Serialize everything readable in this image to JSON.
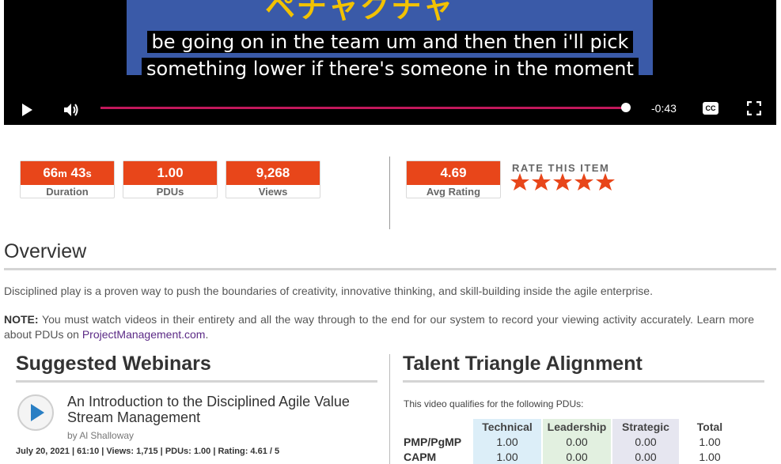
{
  "video": {
    "title_fragment": "ペチャクチャ",
    "caption_line1": "be going on in the team um and then then i'll pick",
    "caption_line2": "something lower if there's someone in the moment",
    "time_remaining": "-0:43",
    "cc_label": "CC",
    "progress": 0.9967
  },
  "stats": [
    {
      "value_main": "66",
      "unit1": "m",
      "value2": "43",
      "unit2": "s",
      "label": "Duration"
    },
    {
      "value": "1.00",
      "label": "PDUs"
    },
    {
      "value": "9,268",
      "label": "Views"
    },
    {
      "value": "4.69",
      "label": "Avg Rating"
    }
  ],
  "rating": {
    "label": "RATE THIS ITEM",
    "star_count": 5,
    "star_color": "#e8461a"
  },
  "overview": {
    "heading": "Overview",
    "description": "Disciplined play is a proven way to push the boundaries of creativity, innovative thinking, and skill-building inside the agile enterprise.",
    "note_label": "NOTE:",
    "note_text": " You must watch videos in their entirety and all the way through to the end for our system to record your viewing activity accurately. Learn more about PDUs on ",
    "note_link": "ProjectManagement.com",
    "note_end": "."
  },
  "suggested": {
    "heading": "Suggested Webinars",
    "items": [
      {
        "title": "An Introduction to the Disciplined Agile Value Stream Management",
        "author": "by Al Shalloway",
        "meta": "July 20, 2021 | 61:10 | Views: 1,715 | PDUs: 1.00 | Rating: 4.61 / 5"
      }
    ]
  },
  "talent": {
    "heading": "Talent Triangle Alignment",
    "qualifies": "This video qualifies for the following PDUs:",
    "columns": [
      "Technical",
      "Leadership",
      "Strategic",
      "Total"
    ],
    "rows": [
      {
        "label": "PMP/PgMP",
        "values": [
          "1.00",
          "0.00",
          "0.00",
          "1.00"
        ]
      },
      {
        "label": "CAPM",
        "values": [
          "1.00",
          "0.00",
          "0.00",
          "1.00"
        ]
      }
    ]
  },
  "colors": {
    "accent": "#e8461a",
    "progress": "#c2185b",
    "link": "#5b2a86"
  }
}
